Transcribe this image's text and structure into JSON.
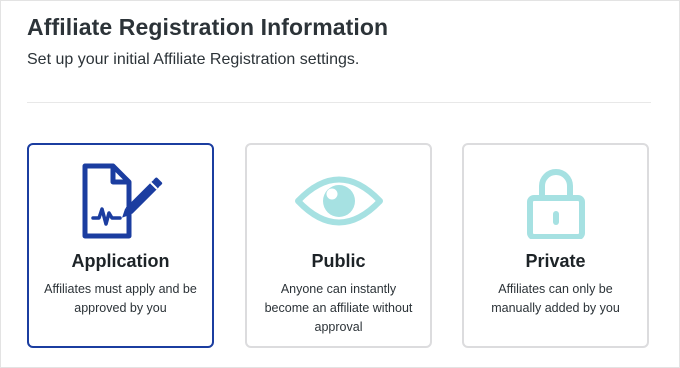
{
  "header": {
    "title": "Affiliate Registration Information",
    "subtitle": "Set up your initial Affiliate Registration settings."
  },
  "colors": {
    "selected_border": "#1b3da0",
    "selected_icon": "#1b3da0",
    "unselected_icon": "#a6e1e2",
    "card_border": "#dcdcde"
  },
  "options": [
    {
      "title": "Application",
      "description": "Affiliates must apply and be approved by you",
      "icon": "document-signature-icon",
      "selected": true
    },
    {
      "title": "Public",
      "description": "Anyone can instantly become an affiliate without approval",
      "icon": "eye-icon",
      "selected": false
    },
    {
      "title": "Private",
      "description": "Affiliates can only be manually added by you",
      "icon": "lock-icon",
      "selected": false
    }
  ]
}
